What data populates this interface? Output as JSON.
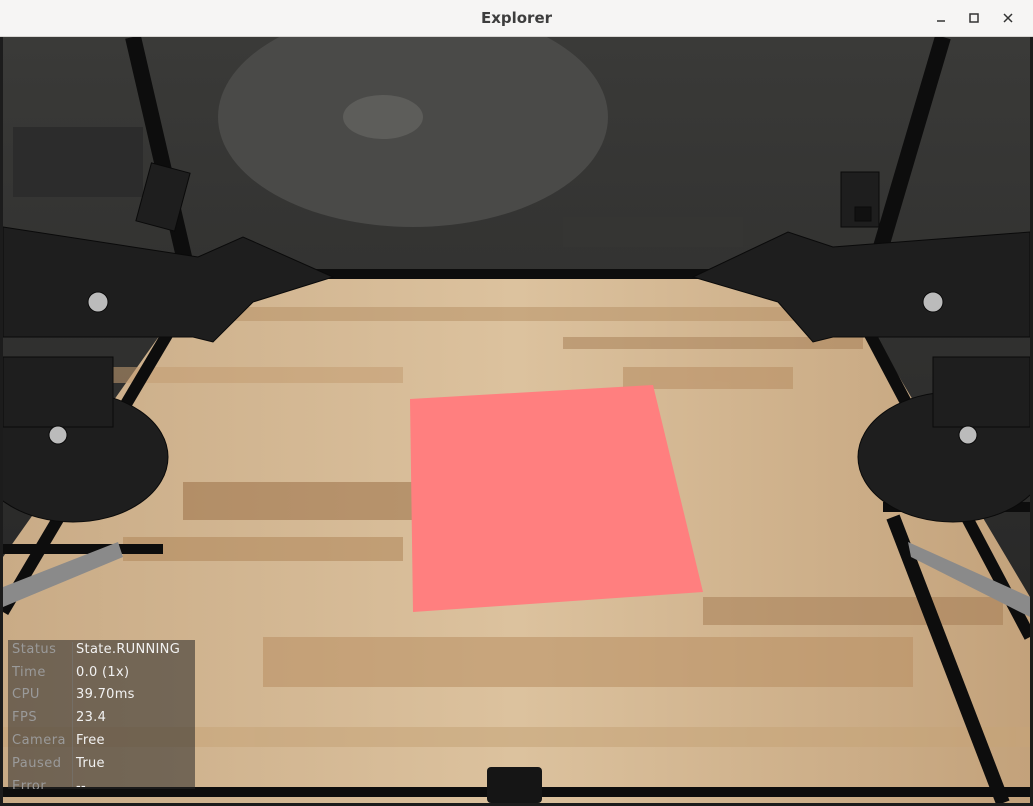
{
  "window": {
    "title": "Explorer"
  },
  "controls": {
    "minimize": "minimize",
    "maximize": "maximize",
    "close": "close"
  },
  "hud": {
    "rows": [
      {
        "label": "Status",
        "value": "State.RUNNING"
      },
      {
        "label": "Time",
        "value": "0.0 (1x)"
      },
      {
        "label": "CPU",
        "value": "39.70ms"
      },
      {
        "label": "FPS",
        "value": "23.4"
      },
      {
        "label": "Camera",
        "value": "Free"
      },
      {
        "label": "Paused",
        "value": "True"
      },
      {
        "label": "Error",
        "value": "--"
      }
    ]
  },
  "scene": {
    "object_color": "#ff7f7f",
    "table_color": "#d7b894",
    "frame_color": "#0d0d0d"
  }
}
